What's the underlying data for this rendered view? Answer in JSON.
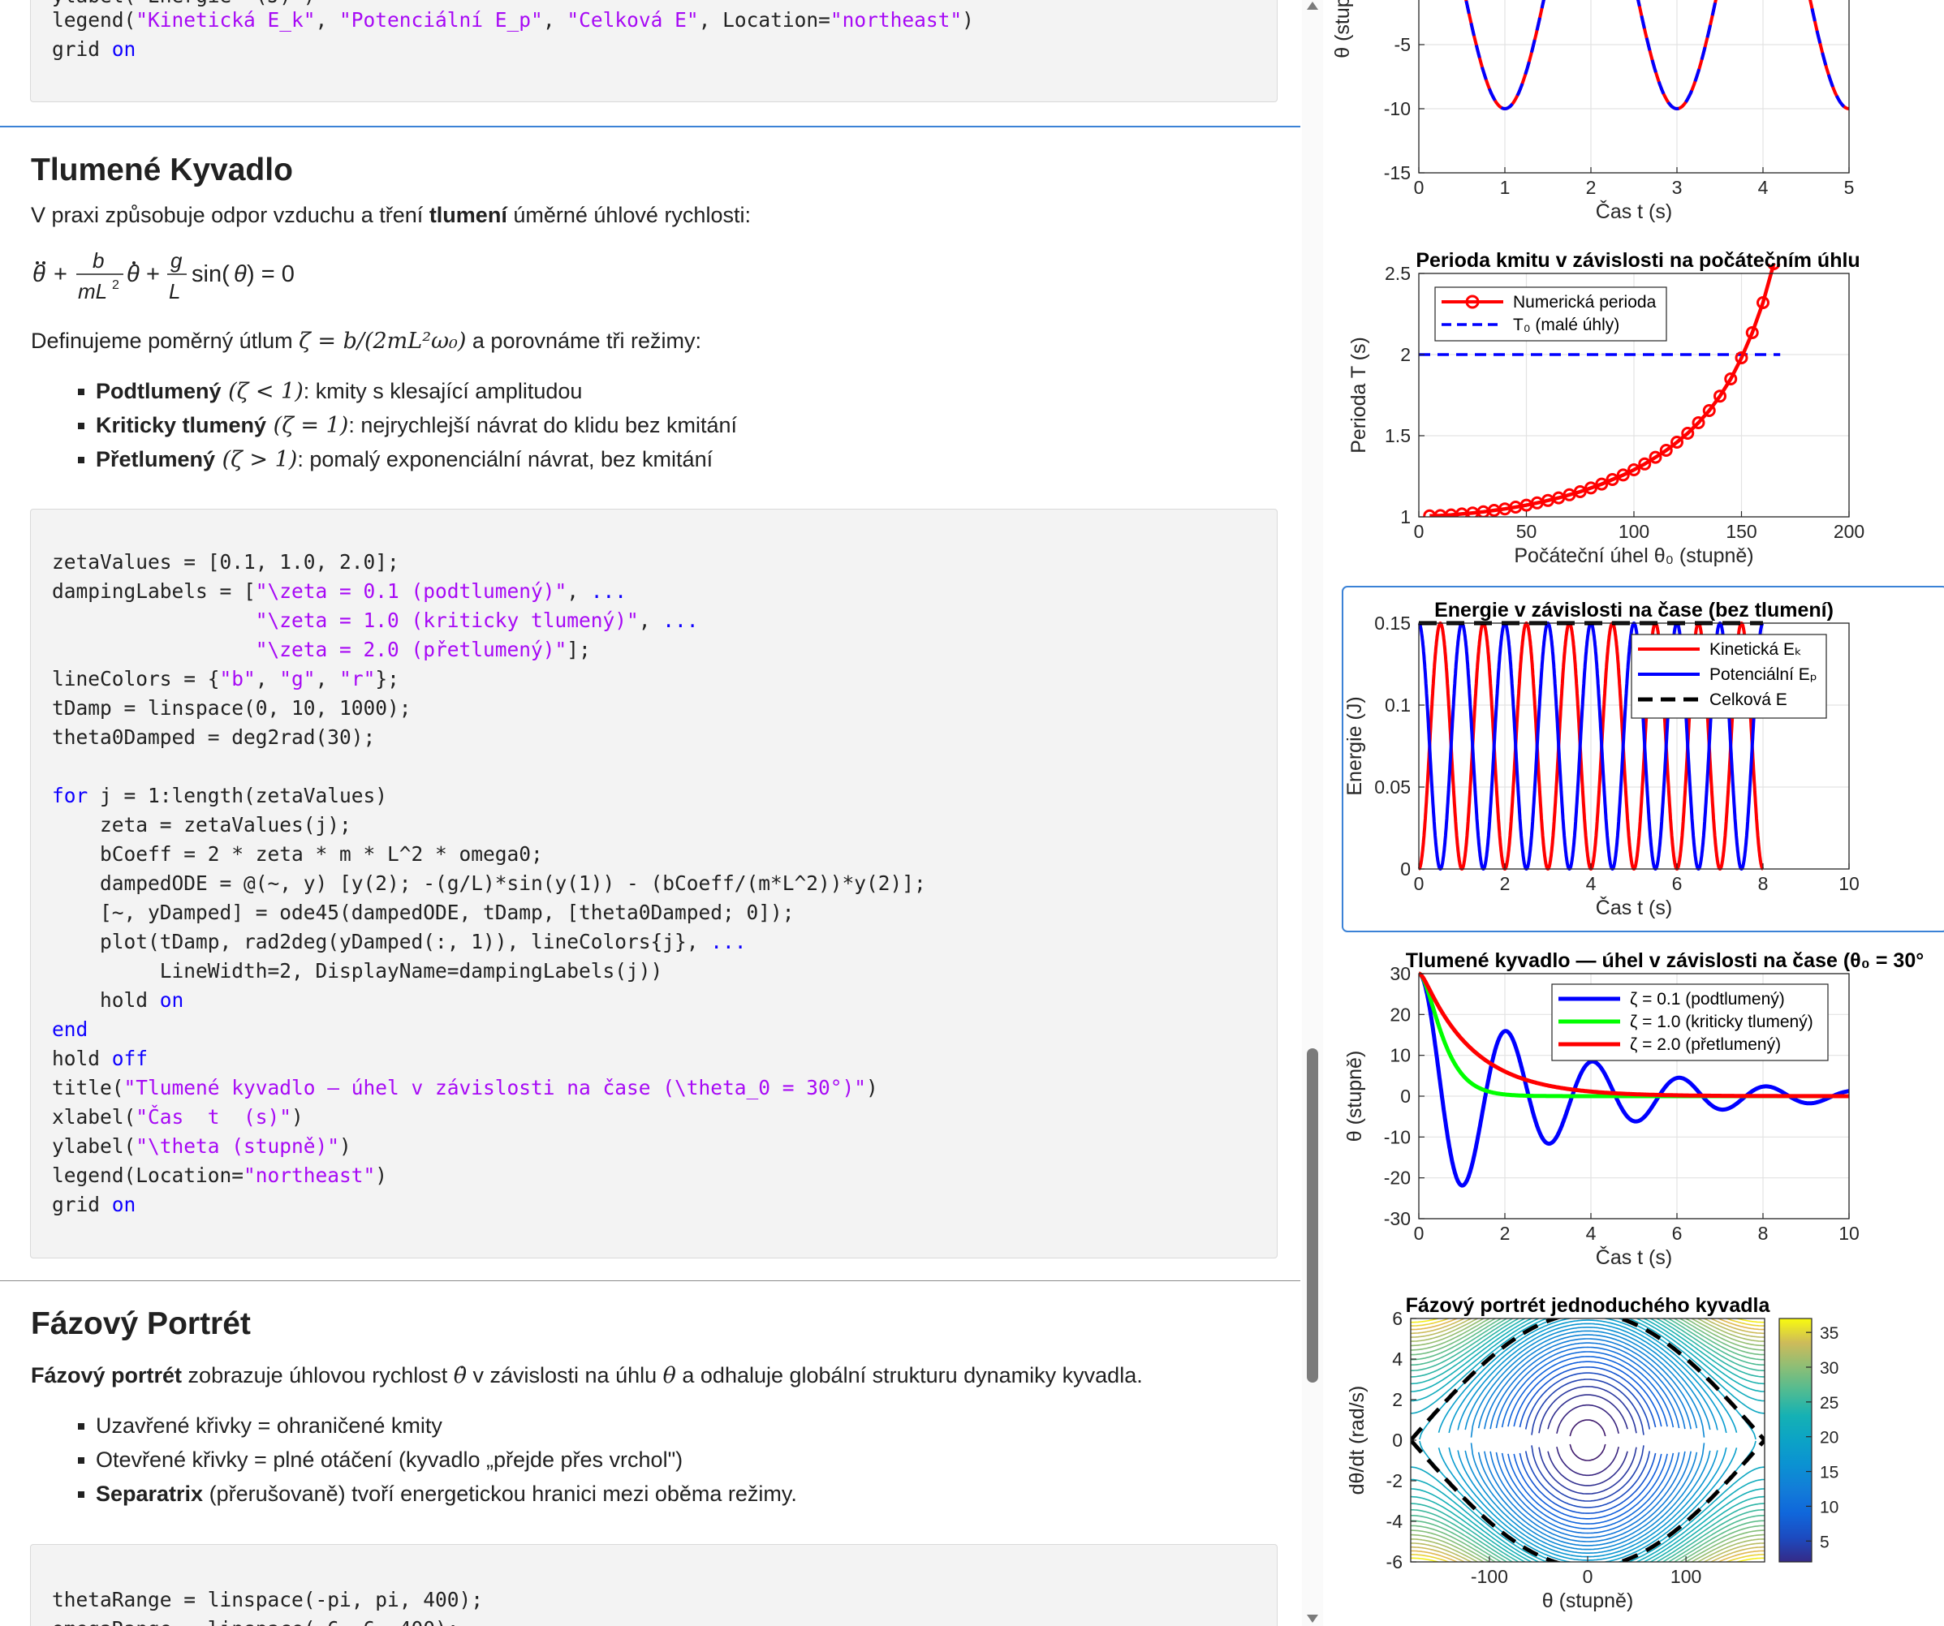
{
  "top_code": {
    "line1_partial": "ylabel(\"Energie  (J)\")",
    "line2": {
      "pre": "legend(",
      "s1": "\"Kinetická E_k\"",
      "c1": ", ",
      "s2": "\"Potenciální E_p\"",
      "c2": ", ",
      "s3": "\"Celková E\"",
      "c3": ", Location=",
      "s4": "\"northeast\"",
      "post": ")"
    },
    "line3": {
      "pre": "grid ",
      "kw": "on"
    }
  },
  "damped_section": {
    "heading": "Tlumené Kyvadlo",
    "intro_pre": "V praxi způsobuje odpor vzduchu a tření ",
    "intro_bold": "tlumení",
    "intro_post": " úměrné úhlové rychlosti:",
    "equation": "θ̈ + b/(mL²) θ̇ + g/L sin(θ) = 0",
    "define_pre": "Definujeme poměrný útlum ",
    "define_math": "ζ = b/(2mL²ω₀)",
    "define_post": " a porovnáme tři režimy:",
    "bullets": [
      {
        "bold": "Podtlumený",
        "math": " (ζ < 1)",
        "rest": ": kmity s klesající amplitudou"
      },
      {
        "bold": "Kriticky tlumený",
        "math": " (ζ = 1)",
        "rest": ": nejrychlejší návrat do klidu bez kmitání"
      },
      {
        "bold": "Přetlumený",
        "math": " (ζ > 1)",
        "rest": ": pomalý exponenciální návrat, bez kmitání"
      }
    ],
    "code": [
      "zetaValues = [0.1, 1.0, 2.0];",
      "dampingLabels = [\"\\zeta = 0.1 (podtlumený)\", ...",
      "                 \"\\zeta = 1.0 (kriticky tlumený)\", ...",
      "                 \"\\zeta = 2.0 (přetlumený)\"];",
      "lineColors = {\"b\", \"g\", \"r\"};",
      "tDamp = linspace(0, 10, 1000);",
      "theta0Damped = deg2rad(30);",
      "",
      "for j = 1:length(zetaValues)",
      "    zeta = zetaValues(j);",
      "    bCoeff = 2 * zeta * m * L^2 * omega0;",
      "    dampedODE = @(~, y) [y(2); -(g/L)*sin(y(1)) - (bCoeff/(m*L^2))*y(2)];",
      "    [~, yDamped] = ode45(dampedODE, tDamp, [theta0Damped; 0]);",
      "    plot(tDamp, rad2deg(yDamped(:, 1)), lineColors{j}, ...",
      "         LineWidth=2, DisplayName=dampingLabels(j))",
      "    hold on",
      "end",
      "hold off",
      "title(\"Tlumené kyvadlo — úhel v závislosti na čase (\\theta_0 = 30°)\")",
      "xlabel(\"Čas  t  (s)\")",
      "ylabel(\"\\theta (stupně)\")",
      "legend(Location=\"northeast\")",
      "grid on"
    ]
  },
  "phase_section": {
    "heading": "Fázový Portrét",
    "intro_bold": "Fázový portrét",
    "intro_mid": " zobrazuje úhlovou rychlost ",
    "intro_math1": "θ̇",
    "intro_mid2": " v závislosti na úhlu ",
    "intro_math2": "θ",
    "intro_post": " a odhaluje globální strukturu dynamiky kyvadla.",
    "bullets": [
      {
        "bold": "",
        "rest": "Uzavřené křivky = ohraničené kmity"
      },
      {
        "bold": "",
        "rest": "Otevřené křivky = plné otáčení (kyvadlo „přejde přes vrchol\")"
      },
      {
        "bold": "Separatrix",
        "rest": " (přerušovaně) tvoří energetickou hranici mezi oběma režimy."
      }
    ],
    "code": [
      "",
      "thetaRange = linspace(-pi, pi, 400);",
      "omegaRange = linspace(-6, 6, 400);"
    ]
  },
  "chart_data": [
    {
      "type": "line",
      "title": "",
      "xlabel": "Čas  t  (s)",
      "ylabel": "θ (stupně)",
      "xlim": [
        0,
        5
      ],
      "ylim": [
        -15,
        10
      ],
      "xticks": [
        "0",
        "1",
        "2",
        "3",
        "4",
        "5"
      ],
      "yticks": [
        "-15",
        "-10",
        "-5",
        "0"
      ],
      "grid": true,
      "series": [
        {
          "color": "#ff0000",
          "style": "solid",
          "x": [
            0,
            1,
            2,
            3,
            4,
            5
          ],
          "y": [
            10,
            -10,
            10,
            -10,
            10,
            -10
          ]
        },
        {
          "color": "#0000ff",
          "style": "dashed",
          "x": [
            0,
            1,
            2,
            3,
            4,
            5
          ],
          "y": [
            10,
            -10,
            10,
            -10,
            10,
            -10
          ]
        }
      ]
    },
    {
      "type": "line",
      "title": "Perioda kmitu v závislosti na počátečním úhlu",
      "xlabel": "Počáteční úhel θ₀ (stupně)",
      "ylabel": "Perioda  T  (s)",
      "xlim": [
        0,
        200
      ],
      "ylim": [
        1,
        2.5
      ],
      "xticks": [
        "0",
        "50",
        "100",
        "150",
        "200"
      ],
      "yticks": [
        "1",
        "1.5",
        "2",
        "2.5"
      ],
      "grid": true,
      "legend_position": "top-left",
      "series": [
        {
          "name": "Numerická perioda",
          "color": "#ff0000",
          "x": [
            5,
            10,
            15,
            20,
            25,
            30,
            35,
            40,
            45,
            50,
            55,
            60,
            65,
            70,
            75,
            80,
            85,
            90,
            95,
            100,
            105,
            110,
            115,
            120,
            125,
            130,
            135,
            140,
            145,
            150,
            155,
            160,
            165,
            170
          ],
          "y": [
            1.006,
            1.008,
            1.012,
            1.018,
            1.024,
            1.031,
            1.04,
            1.049,
            1.06,
            1.072,
            1.086,
            1.101,
            1.117,
            1.136,
            1.155,
            1.178,
            1.202,
            1.23,
            1.258,
            1.29,
            1.326,
            1.367,
            1.41,
            1.46,
            1.515,
            1.58,
            1.655,
            1.744,
            1.85,
            1.98,
            2.135,
            2.32,
            2.56,
            3.0
          ]
        },
        {
          "name": "T₀ (malé úhly)",
          "color": "#0000ff",
          "style": "dashed",
          "x": [
            0,
            168
          ],
          "y": [
            2.0,
            2.0
          ]
        }
      ]
    },
    {
      "type": "line",
      "title": "Energie v závislosti na čase (bez tlumení)",
      "xlabel": "Čas  t  (s)",
      "ylabel": "Energie  (J)",
      "xlim": [
        0,
        10
      ],
      "ylim": [
        0,
        0.15
      ],
      "xticks": [
        "0",
        "2",
        "4",
        "6",
        "8",
        "10"
      ],
      "yticks": [
        "0",
        "0.05",
        "0.1",
        "0.15"
      ],
      "grid": true,
      "legend_position": "top-right",
      "period_s": 1.0,
      "t_end": 8,
      "series": [
        {
          "name": "Kinetická Eₖ",
          "color": "#ff0000",
          "style": "solid",
          "amplitude": 0.15
        },
        {
          "name": "Potenciální Eₚ",
          "color": "#0000ff",
          "style": "solid",
          "amplitude": 0.15
        },
        {
          "name": "Celková E",
          "color": "#000000",
          "style": "dashed",
          "value": 0.15
        }
      ]
    },
    {
      "type": "line",
      "title": "Tlumené kyvadlo — úhel v závislosti na čase (θ₀ = 30°",
      "xlabel": "Čas  t  (s)",
      "ylabel": "θ (stupně)",
      "xlim": [
        0,
        10
      ],
      "ylim": [
        -30,
        30
      ],
      "xticks": [
        "0",
        "2",
        "4",
        "6",
        "8",
        "10"
      ],
      "yticks": [
        "-30",
        "-20",
        "-10",
        "0",
        "10",
        "20",
        "30"
      ],
      "grid": true,
      "legend_position": "top-right",
      "theta0": 30,
      "omega0": 3.13,
      "series": [
        {
          "name": "ζ = 0.1 (podtlumený)",
          "color": "#0000ff",
          "zeta": 0.1
        },
        {
          "name": "ζ = 1.0 (kriticky tlumený)",
          "color": "#00ff00",
          "zeta": 1.0
        },
        {
          "name": "ζ = 2.0 (přetlumený)",
          "color": "#ff0000",
          "zeta": 2.0
        }
      ]
    },
    {
      "type": "contour",
      "title": "Fázový portrét jednoduchého kyvadla",
      "xlabel": "θ (stupně)",
      "ylabel": "dθ/dt  (rad/s)",
      "xlim": [
        -180,
        180
      ],
      "ylim": [
        -6,
        6
      ],
      "xticks": [
        "-100",
        "0",
        "100"
      ],
      "yticks": [
        "-6",
        "-4",
        "-2",
        "0",
        "2",
        "4",
        "6"
      ],
      "colorbar_ticks": [
        "5",
        "10",
        "15",
        "20",
        "25",
        "30",
        "35"
      ],
      "colorbar_range": [
        2,
        37
      ],
      "separatrix_color": "#000000"
    }
  ],
  "colors": {
    "keyword": "#0e00ff",
    "string": "#a709f5",
    "accent": "#3b82d6"
  }
}
